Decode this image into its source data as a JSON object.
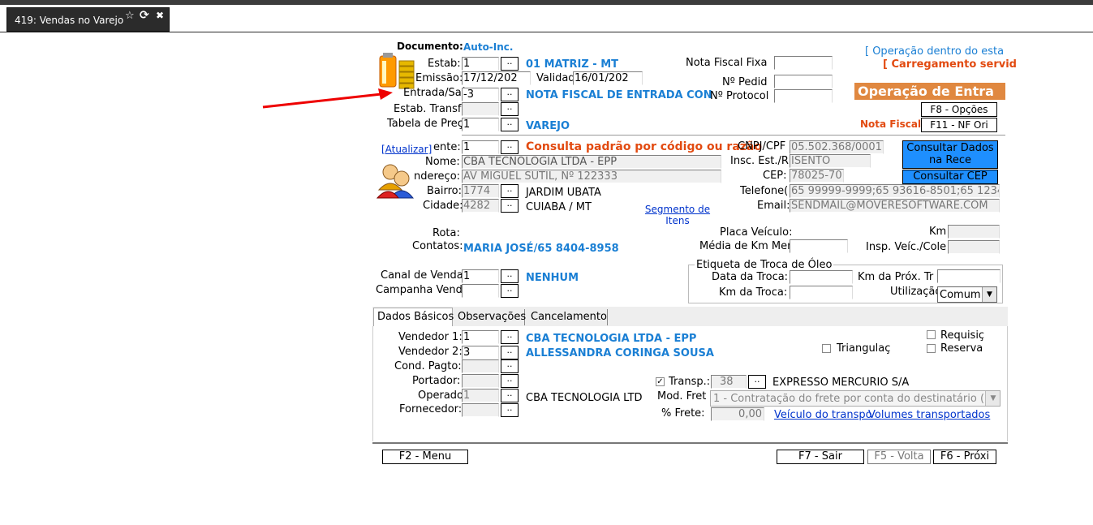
{
  "window": {
    "tab_title": "419: Vendas no Varejo",
    "star_icon": "☆",
    "refresh_icon": "⟳",
    "close_icon": "✖"
  },
  "header": {
    "documento_label": "Documento:",
    "documento_value": "Auto-Inc.",
    "estab_label": "Estab:",
    "estab_value": "1",
    "estab_desc": "01 MATRIZ - MT",
    "emissao_label": "Emissão:",
    "emissao_value": "17/12/202",
    "validad_label": "Validad",
    "validad_value": "16/01/202",
    "entrada_label": "Entrada/Saí",
    "entrada_value": "-3",
    "entrada_desc": "NOTA FISCAL DE ENTRADA CON",
    "estab_transf_label": "Estab. Transf",
    "tabela_label": "Tabela de Preç",
    "tabela_value": "1",
    "tabela_desc": "VAREJO",
    "nota_fiscal_fixa_label": "Nota  Fiscal Fixa",
    "nr_pedid_label": "Nº Pedid",
    "nr_protocol_label": "Nº Protocol",
    "operacao_dentro": "[ Operação dentro do esta",
    "carregamento": "[ Carregamento servid",
    "operacao_entrada_banner": "Operação de Entra",
    "f8_opcoes": "F8 - Opções",
    "nota_fiscal_label": "Nota Fiscal",
    "f11_nf": "F11 - NF Ori"
  },
  "cliente": {
    "atualizar_link": "[Atualizar]",
    "cliente_label": "ente:",
    "cliente_value": "1",
    "consulta_text": "Consulta padrão por código ou razão",
    "nome_label": "Nome:",
    "nome_value": "CBA TECNOLOGIA LTDA - EPP",
    "endereco_label": "ndereço:",
    "endereco_value": "AV MIGUEL SUTIL, Nº 122333",
    "bairro_label": "Bairro:",
    "bairro_code": "1774",
    "bairro_desc": "JARDIM UBATA",
    "cidade_label": "Cidade:",
    "cidade_code": "4282",
    "cidade_desc": "CUIABA / MT",
    "segmento_link": "Segmento de Itens",
    "cnpj_label": "CNPJ/CPF",
    "cnpj_value": "05.502.368/0001",
    "insc_label": "Insc. Est./R",
    "insc_value": "ISENTO",
    "cep_label": "CEP:",
    "cep_value": "78025-70",
    "telefone_label": "Telefone(",
    "telefone_value": "65 99999-9999;65 93616-8501;65 1234",
    "email_label": "Email:",
    "email_value": "SENDMAIL@MOVERESOFTWARE.COM",
    "consultar_receita": "Consultar Dados na Rece",
    "consultar_cep": "Consultar CEP"
  },
  "rota": {
    "rota_label": "Rota:",
    "contatos_label": "Contatos:",
    "contatos_value": "MARIA JOSÉ/65 8404-8958",
    "placa_label": "Placa Veículo:",
    "km_label": "Km",
    "media_label": "Média de Km Men",
    "insp_label": "Insp. Veíc./Cole"
  },
  "canal": {
    "canal_label": "Canal de Venda",
    "canal_value": "1",
    "canal_desc": "NENHUM",
    "campanha_label": "Campanha Vend",
    "etiqueta_title": "Etiqueta de Troca de Óleo",
    "data_troca_label": "Data da Troca:",
    "km_prox_label": "Km da Próx. Tr",
    "km_troca_label": "Km da Troca:",
    "utilizacao_label": "Utilização",
    "utilizacao_value": "Comum"
  },
  "tabs": [
    {
      "label": "Dados Básicos"
    },
    {
      "label": "Observações"
    },
    {
      "label": "Cancelamento"
    }
  ],
  "dados": {
    "vendedor1_label": "Vendedor 1:",
    "vendedor1_value": "1",
    "vendedor1_desc": "CBA TECNOLOGIA LTDA - EPP",
    "vendedor2_label": "Vendedor 2:",
    "vendedor2_value": "3",
    "vendedor2_desc": "ALLESSANDRA CORINGA SOUSA",
    "cond_label": "Cond. Pagto:",
    "portador_label": "Portador:",
    "operado_label": "Operado",
    "operado_value": "1",
    "operado_desc": "CBA TECNOLOGIA LTD",
    "fornecedor_label": "Fornecedor:",
    "triangulac_label": "Triangulaç",
    "requisic_label": "Requisiç",
    "reserva_label": "Reserva",
    "transp_label": "Transp.:",
    "transp_value": "38",
    "transp_desc": "EXPRESSO MERCURIO S/A",
    "mod_frete_label": "Mod. Fret",
    "mod_frete_value": "1 - Contratação do frete por conta do destinatário (FO",
    "frete_label": "% Frete:",
    "frete_value": "0,00",
    "veiculo_link": "Veículo do transpo",
    "volumes_link": "Volumes transportados"
  },
  "footer": {
    "f2": "F2 - Menu",
    "f7": "F7 - Sair",
    "f5": "F5 - Volta",
    "f6": "F6 - Próxi"
  }
}
